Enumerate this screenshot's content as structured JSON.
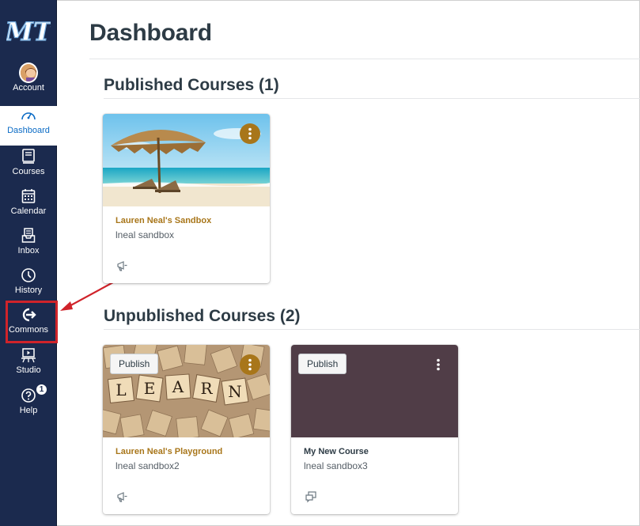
{
  "colors": {
    "nav_bg": "#1b2a4e",
    "active_text": "#0b6bc5",
    "accent_gold": "#a8761a",
    "highlight_red": "#d0232a",
    "plum": "#503d47"
  },
  "nav": {
    "logo": "MT",
    "items": [
      {
        "label": "Account",
        "icon": "avatar"
      },
      {
        "label": "Dashboard",
        "icon": "speedometer-icon",
        "active": true
      },
      {
        "label": "Courses",
        "icon": "courses-icon"
      },
      {
        "label": "Calendar",
        "icon": "calendar-icon"
      },
      {
        "label": "Inbox",
        "icon": "inbox-icon"
      },
      {
        "label": "History",
        "icon": "clock-icon"
      },
      {
        "label": "Commons",
        "icon": "commons-icon"
      },
      {
        "label": "Studio",
        "icon": "studio-icon"
      },
      {
        "label": "Help",
        "icon": "help-icon",
        "badge": "1"
      }
    ]
  },
  "main": {
    "title": "Dashboard",
    "published": {
      "heading": "Published Courses (1)",
      "cards": [
        {
          "name": "Lauren Neal's Sandbox",
          "sub": "lneal sandbox",
          "name_color": "#a8761a"
        }
      ]
    },
    "unpublished": {
      "heading": "Unpublished Courses (2)",
      "cards": [
        {
          "name": "Lauren Neal's Playground",
          "sub": "lneal sandbox2",
          "publish_label": "Publish",
          "name_color": "#a8761a"
        },
        {
          "name": "My New Course",
          "sub": "lneal sandbox3",
          "publish_label": "Publish",
          "name_color": "#2d3b45"
        }
      ]
    }
  }
}
